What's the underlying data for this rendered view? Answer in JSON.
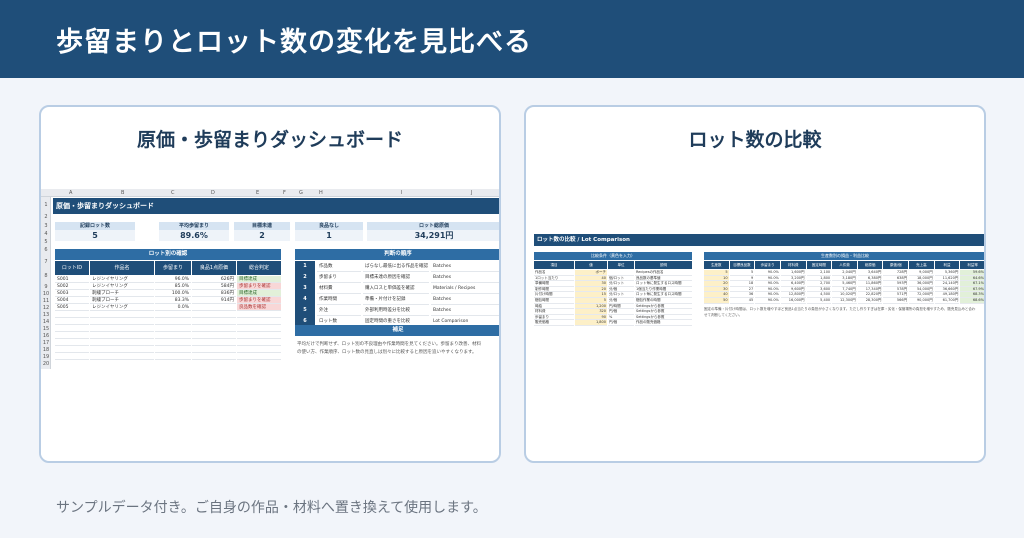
{
  "header": {
    "title": "歩留まりとロット数の変化を見比べる"
  },
  "left_card": {
    "title": "原価・歩留まりダッシュボード",
    "col_letters": [
      "A",
      "B",
      "C",
      "D",
      "E",
      "F",
      "G",
      "H",
      "I",
      "J"
    ],
    "row_numbers": [
      "1",
      "2",
      "3",
      "4",
      "5",
      "6",
      "7",
      "8",
      "9",
      "10",
      "11",
      "12",
      "13",
      "14",
      "15",
      "16",
      "17",
      "18",
      "19",
      "20"
    ],
    "sheet_title": "原価・歩留まりダッシュボード",
    "kpis": [
      {
        "label": "記録ロット数",
        "value": "5"
      },
      {
        "label": "平均歩留まり",
        "value": "89.6%"
      },
      {
        "label": "目標未達",
        "value": "2"
      },
      {
        "label": "良品なし",
        "value": "1"
      },
      {
        "label": "ロット総原価",
        "value": "34,291円"
      }
    ],
    "lot_section": "ロット別の確認",
    "lot_headers": [
      "ロットID",
      "作品名",
      "歩留まり",
      "良品1点原価",
      "総合判定"
    ],
    "lot_rows": [
      {
        "id": "S001",
        "name": "レジンイヤリング",
        "yield": "96.0%",
        "cost": "626円",
        "judge": "目標達成",
        "status": "ok"
      },
      {
        "id": "S002",
        "name": "レジンイヤリング",
        "yield": "85.0%",
        "cost": "584円",
        "judge": "歩留まりを確認",
        "status": "ng"
      },
      {
        "id": "S003",
        "name": "刺繍ブローチ",
        "yield": "100.0%",
        "cost": "836円",
        "judge": "目標達成",
        "status": "ok"
      },
      {
        "id": "S004",
        "name": "刺繍ブローチ",
        "yield": "83.3%",
        "cost": "914円",
        "judge": "歩留まりを確認",
        "status": "ng"
      },
      {
        "id": "S005",
        "name": "レジンイヤリング",
        "yield": "0.0%",
        "cost": "",
        "judge": "良品数を確認",
        "status": "ng"
      }
    ],
    "order_section": "判断の順序",
    "steps": [
      {
        "num": "1",
        "item": "作品数",
        "desc": "ばらなし最低に出る作品を確認",
        "sheet": "Batches"
      },
      {
        "num": "2",
        "item": "歩留まり",
        "desc": "目標未達の原因を確認",
        "sheet": "Batches"
      },
      {
        "num": "3",
        "item": "材料費",
        "desc": "購入ロスと単価差を確認",
        "sheet": "Materials / Recipes"
      },
      {
        "num": "4",
        "item": "作業時間",
        "desc": "準備・片付けを記録",
        "sheet": "Batches"
      },
      {
        "num": "5",
        "item": "外注",
        "desc": "外部利用時差分を比較",
        "sheet": "Batches"
      },
      {
        "num": "6",
        "item": "ロット数",
        "desc": "固定時間の重さを比較",
        "sheet": "Lot Comparison"
      }
    ],
    "note_section": "補足",
    "note_lines": [
      "平均だけで判断せず、ロット別の不良理由や作業時間を見てください。歩留まり改善、材料",
      "の使い方、作業順序、ロット数の見直しは別々に比較すると原因を追いやすくなります。"
    ]
  },
  "right_card": {
    "title": "ロット数の比較",
    "sheet_title": "ロット数の比較 / Lot Comparison",
    "cond_section": "比較条件（黄色を入力）",
    "cond_headers": [
      "項目",
      "値",
      "単位",
      "説明"
    ],
    "cond_rows": [
      [
        "作品名",
        "ポーチ",
        "",
        "Recipesの作品名"
      ],
      [
        "1ロット当たり",
        "40",
        "個/ロット",
        "良品数の基準値"
      ],
      [
        "準備時間",
        "30",
        "分/ロット",
        "ロット毎に発生するロス時間"
      ],
      [
        "制作時間",
        "20",
        "分/個",
        "1個当たり作業時間"
      ],
      [
        "片付け時間",
        "15",
        "分/ロット",
        "ロット毎に発生するロス時間"
      ],
      [
        "梱包時間",
        "5",
        "分/個",
        "梱包作業の時間"
      ],
      [
        "時給",
        "1,200",
        "円/時間",
        "Settingsから参照"
      ],
      [
        "材料費",
        "320",
        "円/個",
        "Settingsから参照"
      ],
      [
        "歩留まり",
        "90",
        "%",
        "Settingsから参照"
      ],
      [
        "販売価格",
        "1,800",
        "円/個",
        "作品の販売価格"
      ]
    ],
    "result_section": "生産数別の損益・利益比較",
    "result_headers": [
      "生産数",
      "目標良品数",
      "歩留まり",
      "材料費",
      "固定時間",
      "人件費",
      "総原価",
      "原価/個",
      "売上高",
      "利益",
      "利益率"
    ],
    "result_rows": [
      [
        "5",
        "5",
        "90.0%",
        "1,600円",
        "2,100",
        "2,040円",
        "3,640円",
        "728円",
        "9,000円",
        "5,360円",
        "59.6%"
      ],
      [
        "10",
        "9",
        "90.0%",
        "3,200円",
        "1,800",
        "3,180円",
        "6,380円",
        "638円",
        "18,000円",
        "11,620円",
        "64.6%"
      ],
      [
        "20",
        "18",
        "90.0%",
        "6,400円",
        "2,700",
        "5,460円",
        "11,860円",
        "593円",
        "36,000円",
        "24,140円",
        "67.1%"
      ],
      [
        "30",
        "27",
        "90.0%",
        "9,600円",
        "3,600",
        "7,740円",
        "17,340円",
        "578円",
        "54,000円",
        "36,660円",
        "67.9%"
      ],
      [
        "40",
        "36",
        "90.0%",
        "12,800円",
        "4,500",
        "10,020円",
        "22,820円",
        "571円",
        "72,000円",
        "49,180円",
        "68.3%"
      ],
      [
        "50",
        "45",
        "90.0%",
        "16,000円",
        "5,400",
        "12,300円",
        "28,300円",
        "566円",
        "90,000円",
        "61,700円",
        "68.6%"
      ]
    ],
    "note_lines": [
      "固定の準備・片付け時間は、ロット数を増やすほど良品1点当たりの負担が小さくなります。ただし作りすぎは在庫・劣化・保管場所の負担を増やすため、販売見込みと合わ",
      "せて判断してください。"
    ]
  },
  "footer": {
    "text": "サンプルデータ付き。ご自身の作品・材料へ置き換えて使用します。"
  }
}
